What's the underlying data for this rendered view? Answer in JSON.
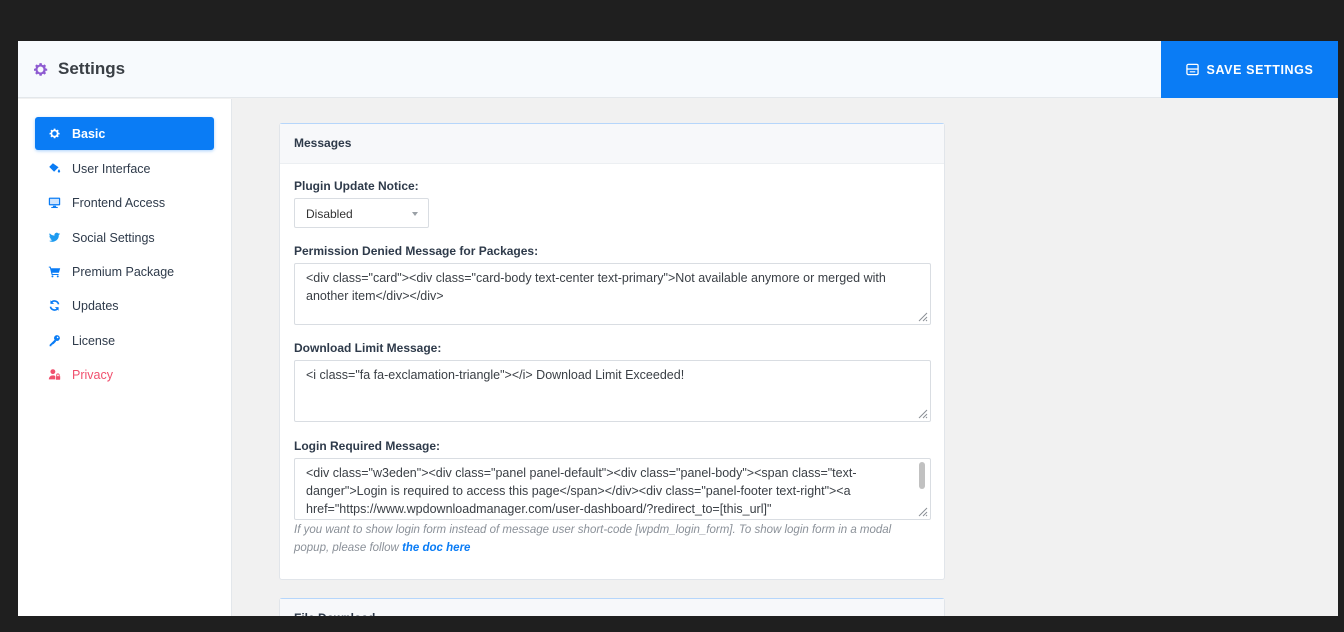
{
  "header": {
    "title": "Settings",
    "save_label": "SAVE SETTINGS",
    "icon": "gear-icon",
    "save_icon": "save-icon"
  },
  "sidebar": {
    "items": [
      {
        "label": "Basic",
        "icon": "gear-icon",
        "active": true
      },
      {
        "label": "User Interface",
        "icon": "paint-bucket-icon"
      },
      {
        "label": "Frontend Access",
        "icon": "monitor-icon"
      },
      {
        "label": "Social Settings",
        "icon": "twitter-icon"
      },
      {
        "label": "Premium Package",
        "icon": "cart-icon"
      },
      {
        "label": "Updates",
        "icon": "sync-icon"
      },
      {
        "label": "License",
        "icon": "key-icon"
      },
      {
        "label": "Privacy",
        "icon": "user-lock-icon"
      }
    ]
  },
  "messages": {
    "title": "Messages",
    "plugin_update_label": "Plugin Update Notice:",
    "plugin_update_value": "Disabled",
    "permission_label": "Permission Denied Message for Packages:",
    "permission_value": "<div class=\"card\"><div class=\"card-body text-center text-primary\">Not available anymore or merged with another item</div></div>",
    "download_limit_label": "Download Limit Message:",
    "download_limit_value": "<i class=\"fa fa-exclamation-triangle\"></i> Download Limit Exceeded!",
    "login_label": "Login Required Message:",
    "login_value": "<div class=\"w3eden\"><div class=\"panel panel-default\"><div class=\"panel-body\"><span class=\"text-danger\">Login is required to access this page</span></div><div class=\"panel-footer text-right\"><a href=\"https://www.wpdownloadmanager.com/user-dashboard/?redirect_to=[this_url]\"",
    "hint_text": "If you want to show login form instead of message user short-code [wpdm_login_form]. To show login form in a modal popup, please follow ",
    "hint_link": "the doc here"
  },
  "next_section": {
    "title": "File Download"
  },
  "colors": {
    "accent": "#0a7cf5",
    "privacy": "#f0506e",
    "settings_icon": "#8e5bd1"
  }
}
